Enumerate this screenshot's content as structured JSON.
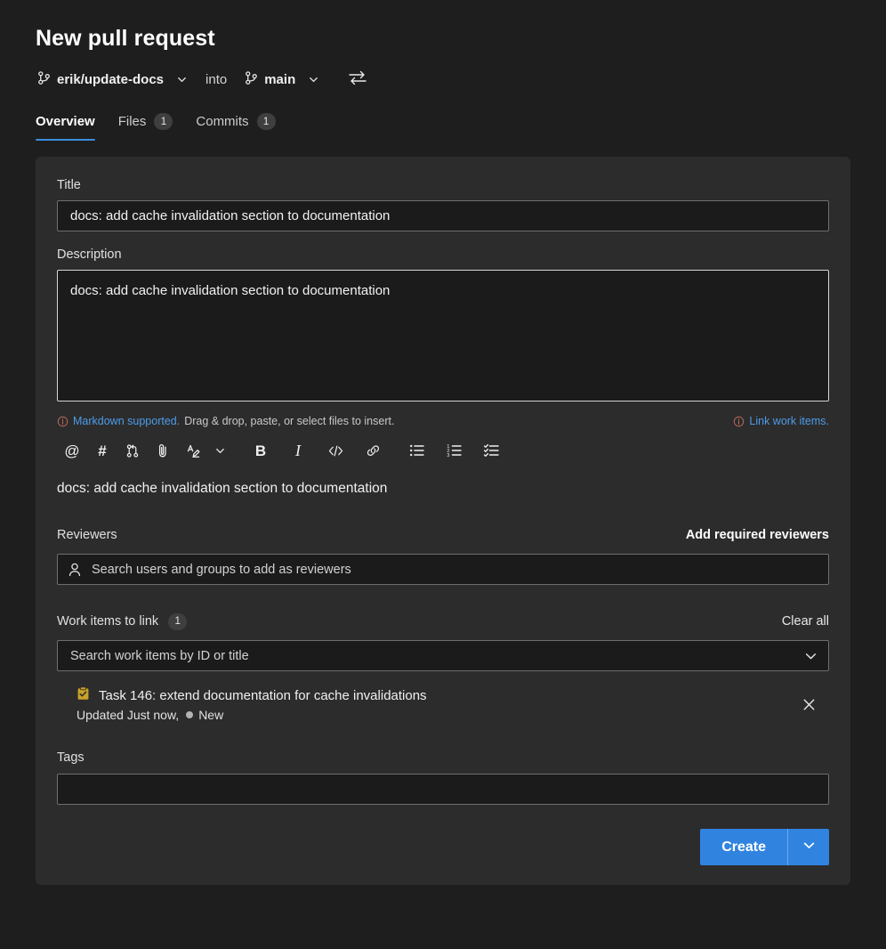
{
  "header": {
    "title": "New pull request",
    "source_branch": "erik/update-docs",
    "into_label": "into",
    "target_branch": "main",
    "branch_icon": "git-branch-icon",
    "swap_icon": "swap-branches-icon",
    "chevron_icon": "chevron-down-icon"
  },
  "tabs": [
    {
      "label": "Overview",
      "badge": "",
      "active": true
    },
    {
      "label": "Files",
      "badge": "1",
      "active": false
    },
    {
      "label": "Commits",
      "badge": "1",
      "active": false
    }
  ],
  "form": {
    "title_label": "Title",
    "title_value": "docs: add cache invalidation section to documentation",
    "title_placeholder": "Title",
    "description_label": "Description",
    "description_value": "docs: add cache invalidation section to documentation",
    "description_placeholder": "Description",
    "markdown_link": "Markdown supported.",
    "markdown_hint": "Drag & drop, paste, or select files to insert.",
    "link_work_items": "Link work items.",
    "markdown_preview": "docs: add cache invalidation section to documentation"
  },
  "toolbar": [
    {
      "name": "mention-icon",
      "glyph": "@"
    },
    {
      "name": "hash-icon",
      "glyph": "#"
    },
    {
      "name": "pull-request-icon",
      "glyph": ""
    },
    {
      "name": "attachment-icon",
      "glyph": ""
    },
    {
      "name": "highlight-icon",
      "glyph": ""
    },
    {
      "name": "highlight-chevron-down-icon",
      "glyph": ""
    },
    {
      "name": "bold-icon",
      "glyph": "B"
    },
    {
      "name": "italic-icon",
      "glyph": "I"
    },
    {
      "name": "code-icon",
      "glyph": "</>"
    },
    {
      "name": "link-icon",
      "glyph": ""
    },
    {
      "name": "bulleted-list-icon",
      "glyph": ""
    },
    {
      "name": "numbered-list-icon",
      "glyph": ""
    },
    {
      "name": "checklist-icon",
      "glyph": ""
    }
  ],
  "reviewers": {
    "label": "Reviewers",
    "action": "Add required reviewers",
    "placeholder": "Search users and groups to add as reviewers",
    "value": "",
    "person_icon": "person-icon"
  },
  "work_items": {
    "label": "Work items to link",
    "count": "1",
    "clear_all": "Clear all",
    "placeholder": "Search work items by ID or title",
    "value": "",
    "chevron_icon": "chevron-down-icon",
    "items": [
      {
        "icon": "task-icon",
        "icon_color": "#c9a227",
        "title": "Task 146: extend documentation for cache invalidations",
        "updated": "Updated Just now,",
        "state": "New",
        "state_color": "#b3b3b3",
        "remove_icon": "close-icon"
      }
    ]
  },
  "tags": {
    "label": "Tags",
    "value": "",
    "placeholder": ""
  },
  "actions": {
    "create_label": "Create",
    "create_chevron_icon": "chevron-down-icon",
    "accent_color": "#3183e0"
  }
}
